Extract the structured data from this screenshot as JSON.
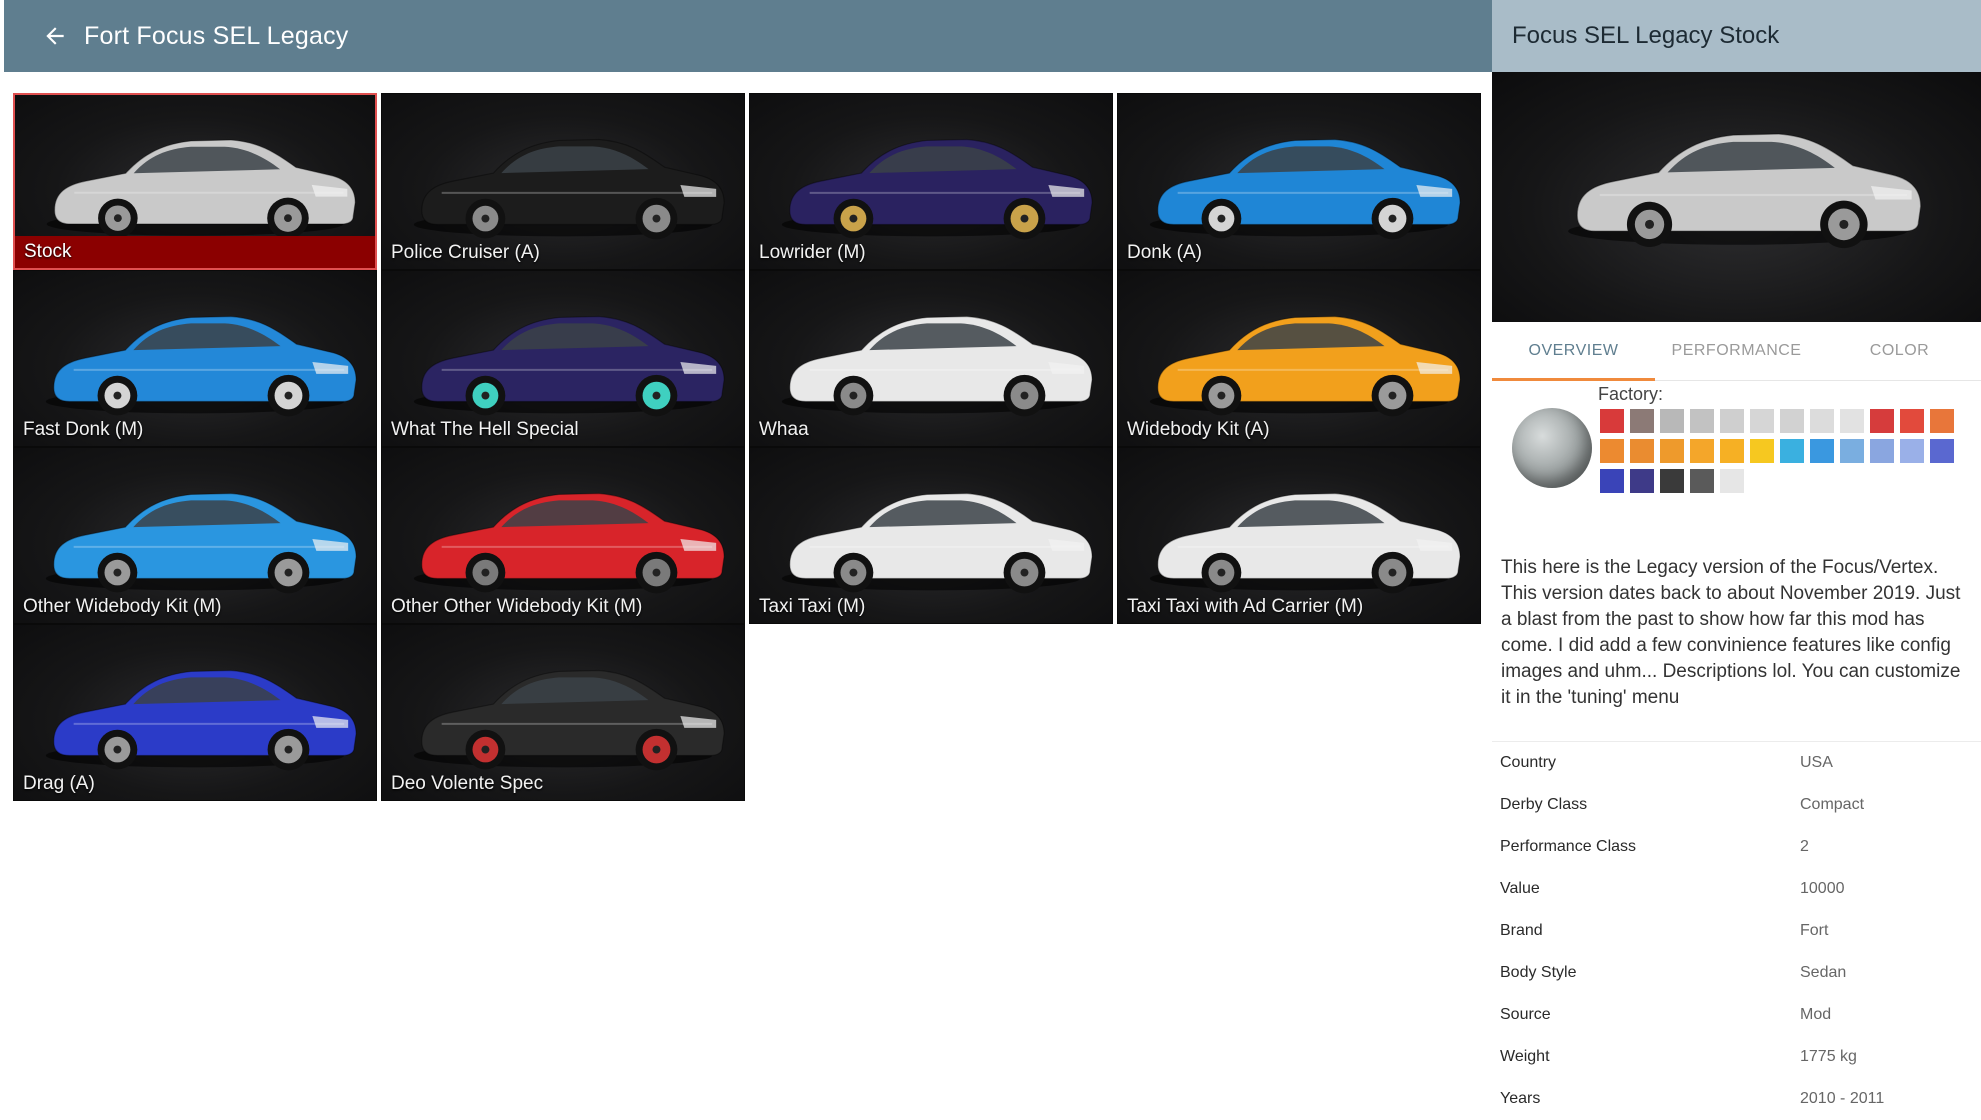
{
  "header": {
    "title": "Fort Focus SEL Legacy"
  },
  "configs": [
    {
      "label": "Stock",
      "color": "#c9c9c9",
      "wheel": "#9a9a9a",
      "selected": true
    },
    {
      "label": "Police Cruiser (A)",
      "color": "#1c1c1c",
      "wheel": "#8a8a8a"
    },
    {
      "label": "Lowrider (M)",
      "color": "#2a2260",
      "wheel": "#c9a24a"
    },
    {
      "label": "Donk (A)",
      "color": "#1f86d6",
      "wheel": "#d4d4d4"
    },
    {
      "label": "Fast Donk (M)",
      "color": "#2388d8",
      "wheel": "#d4d4d4"
    },
    {
      "label": "What The Hell Special",
      "color": "#2b2462",
      "wheel": "#3fd0c0"
    },
    {
      "label": "Whaa",
      "color": "#e8e8e8",
      "wheel": "#8a8a8a"
    },
    {
      "label": "Widebody Kit (A)",
      "color": "#f2a01c",
      "wheel": "#9a9a9a"
    },
    {
      "label": "Other Widebody Kit (M)",
      "color": "#2a96e0",
      "wheel": "#9a9a9a"
    },
    {
      "label": "Other Other Widebody Kit (M)",
      "color": "#d8242a",
      "wheel": "#7a7a7a"
    },
    {
      "label": "Taxi Taxi (M)",
      "color": "#e8e8e8",
      "wheel": "#8a8a8a"
    },
    {
      "label": "Taxi Taxi with Ad Carrier (M)",
      "color": "#e8e8e8",
      "wheel": "#8a8a8a"
    },
    {
      "label": "Drag (A)",
      "color": "#2b3bc8",
      "wheel": "#9a9a9a"
    },
    {
      "label": "Deo Volente Spec",
      "color": "#2a2a2a",
      "wheel": "#c23030"
    }
  ],
  "panel": {
    "title": "Focus SEL Legacy Stock",
    "tabs": [
      "OVERVIEW",
      "PERFORMANCE",
      "COLOR"
    ],
    "active_tab": 0,
    "factory_label": "Factory:",
    "swatches": [
      "#d83a3a",
      "#8c7a76",
      "#b8b8b8",
      "#c2c2c2",
      "#cfcfcf",
      "#d6d6d6",
      "#d2d2d2",
      "#dcdcdc",
      "#e2e2e2",
      "#d63c3c",
      "#e24a3c",
      "#e8763a",
      "#ec8a30",
      "#ea8c30",
      "#ee9a2c",
      "#f4a62a",
      "#f6b024",
      "#f6c820",
      "#3ab0e0",
      "#3a98e0",
      "#7aaee0",
      "#8aa6e0",
      "#9ab0e8",
      "#5a68d0",
      "#3a44b8",
      "#3e3a88",
      "#3a3a3a",
      "#5a5a5a",
      "#e6e6e6"
    ],
    "description": "This here is the Legacy version of the Focus/Vertex. This version dates back to about November 2019. Just a blast from the past to show how far this mod has come. I did add a few convinience features like config images and uhm... Descriptions lol. You can customize it in the 'tuning' menu",
    "specs": [
      {
        "label": "Country",
        "value": "USA"
      },
      {
        "label": "Derby Class",
        "value": "Compact"
      },
      {
        "label": "Performance Class",
        "value": "2"
      },
      {
        "label": "Value",
        "value": "10000"
      },
      {
        "label": "Brand",
        "value": "Fort"
      },
      {
        "label": "Body Style",
        "value": "Sedan"
      },
      {
        "label": "Source",
        "value": "Mod"
      },
      {
        "label": "Weight",
        "value": "1775 kg"
      },
      {
        "label": "Years",
        "value": "2010 - 2011"
      }
    ]
  }
}
